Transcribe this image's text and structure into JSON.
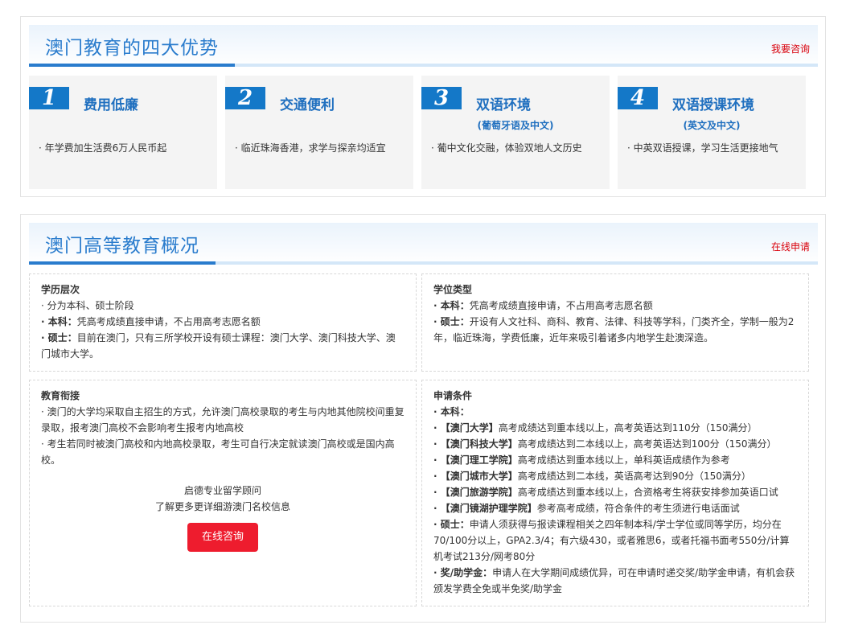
{
  "advantages": {
    "title": "澳门教育的四大优势",
    "link": "我要咨询",
    "cards": [
      {
        "num": "1",
        "title": "费用低廉",
        "sub": "",
        "desc": "·  年学费加生活费6万人民币起"
      },
      {
        "num": "2",
        "title": "交通便利",
        "sub": "",
        "desc": "·  临近珠海香港，求学与探亲均适宜"
      },
      {
        "num": "3",
        "title": "双语环境",
        "sub": "(葡萄牙语及中文)",
        "desc": "·  葡中文化交融，体验双地人文历史"
      },
      {
        "num": "4",
        "title": "双语授课环境",
        "sub": "(英文及中文)",
        "desc": "·  中英双语授课，学习生活更接地气"
      }
    ]
  },
  "overview": {
    "title": "澳门高等教育概况",
    "link": "在线申请",
    "levels": {
      "title": "学历层次",
      "l1": "·  分为本科、硕士阶段",
      "l2_label": "·  本科：",
      "l2": "凭高考成绩直接申请，不占用高考志愿名额",
      "l3_label": "·  硕士：",
      "l3": "目前在澳门，只有三所学校开设有硕士课程：澳门大学、澳门科技大学、澳门城市大学。"
    },
    "degree": {
      "title": "学位类型",
      "l1_label": "·  本科：",
      "l1": "凭高考成绩直接申请，不占用高考志愿名额",
      "l2_label": "·  硕士：",
      "l2": "开设有人文社科、商科、教育、法律、科技等学科，门类齐全，学制一般为2年，临近珠海，学费低廉，近年来吸引着诸多内地学生赴澳深造。"
    },
    "link_up": {
      "title": "教育衔接",
      "l1": "·  澳门的大学均采取自主招生的方式，允许澳门高校录取的考生与内地其他院校间重复录取，报考澳门高校不会影响考生报考内地高校",
      "l2": "·  考生若同时被澳门高校和内地高校录取，考生可自行决定就读澳门高校或是国内高校。",
      "c1": "启德专业留学顾问",
      "c2": "了解更多更详细游澳门名校信息",
      "button": "在线咨询"
    },
    "conditions": {
      "title": "申请条件",
      "bk": "·  本科：",
      "u1_name": "·  【澳门大学】",
      "u1": "高考成绩达到重本线以上，高考英语达到110分（150满分）",
      "u2_name": "·  【澳门科技大学】",
      "u2": "高考成绩达到二本线以上，高考英语达到100分（150满分）",
      "u3_name": "·  【澳门理工学院】",
      "u3": "高考成绩达到重本线以上，单科英语成绩作为参考",
      "u4_name": "·  【澳门城市大学】",
      "u4": "高考成绩达到二本线，英语高考达到90分（150满分）",
      "u5_name": "·  【澳门旅游学院】",
      "u5": "高考成绩达到重本线以上，合资格考生将获安排参加英语口试",
      "u6_name": "·  【澳门镜湖护理学院】",
      "u6": "参考高考成绩，符合条件的考生须进行电话面试",
      "ms_label": "·  硕士：",
      "ms": "申请人须获得与报读课程相关之四年制本科/学士学位或同等学历，均分在70/100分以上，GPA2.3/4；有六级430，或者雅思6，或者托福书面考550分/计算机考试213分/网考80分",
      "sc_label": "·  奖/助学金：",
      "sc": "申请人在大学期间成绩优异，可在申请时递交奖/助学金申请，有机会获颁发学费全免或半免奖/助学金"
    }
  }
}
